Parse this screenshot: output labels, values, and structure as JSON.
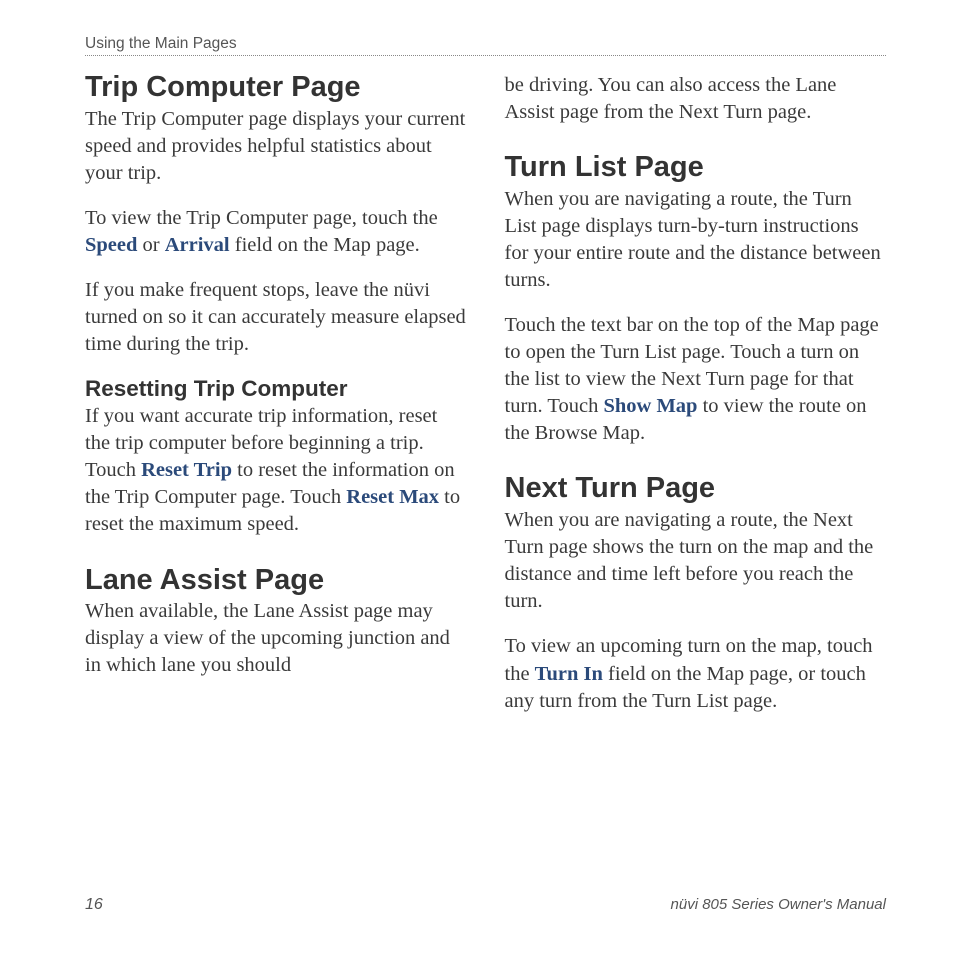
{
  "header": "Using the Main Pages",
  "left": {
    "h1a": "Trip Computer Page",
    "p1": "The Trip Computer page displays your current speed and provides helpful statistics about your trip.",
    "p2_a": "To view the Trip Computer page, touch the ",
    "p2_speed": "Speed",
    "p2_b": " or ",
    "p2_arrival": "Arrival",
    "p2_c": " field on the Map page.",
    "p3": "If you make frequent stops, leave the nüvi turned on so it can accurately measure elapsed time during the trip.",
    "h2": "Resetting Trip Computer",
    "p4_a": "If you want accurate trip information, reset the trip computer before beginning a trip. Touch ",
    "p4_reset_trip": "Reset Trip",
    "p4_b": " to reset the information on the Trip Computer page. Touch ",
    "p4_reset_max": "Reset Max",
    "p4_c": " to reset the maximum speed.",
    "h1b": "Lane Assist Page",
    "p5": "When available, the Lane Assist page may display a view of the upcoming junction and in which lane you should"
  },
  "right": {
    "p0": "be driving. You can also access the Lane Assist page from the Next Turn page.",
    "h1a": "Turn List Page",
    "p1": "When you are navigating a route, the Turn List page displays turn-by-turn instructions for your entire route and the distance between turns.",
    "p2_a": "Touch the text bar on the top of the Map page to open the Turn List page. Touch a turn on the list to view the Next Turn page for that turn. Touch ",
    "p2_show_map": "Show Map",
    "p2_b": " to view the route on the Browse Map.",
    "h1b": "Next Turn Page",
    "p3": "When you are navigating a route, the Next Turn page shows the turn on the map and the distance and time left before you reach the turn.",
    "p4_a": "To view an upcoming turn on the map, touch the ",
    "p4_turn_in": "Turn In",
    "p4_b": " field on the Map page, or touch any turn from the Turn List page."
  },
  "footer": {
    "page": "16",
    "title": "nüvi 805 Series Owner's Manual"
  }
}
